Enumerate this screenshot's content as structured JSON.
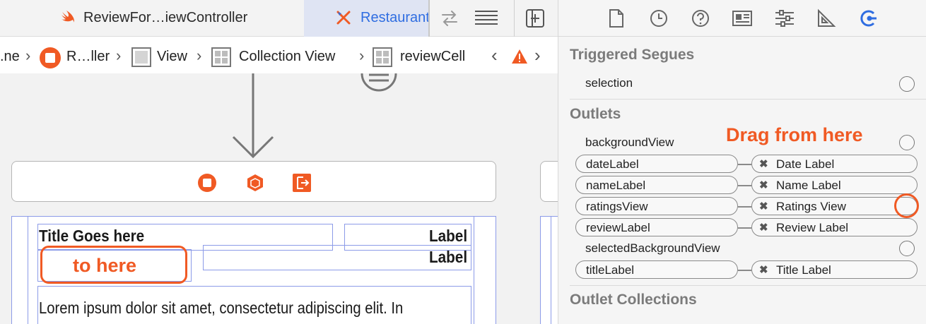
{
  "tabs": [
    {
      "label": "ReviewFor…iewController",
      "icon": "swift-icon",
      "active": false
    },
    {
      "label": "Restaurant",
      "icon": "storyboard-icon",
      "active": true
    }
  ],
  "toolbar_icons": [
    "swap-arrows-icon",
    "lines-icon",
    "add-editor-icon"
  ],
  "breadcrumbs": [
    {
      "label": ".ne",
      "icon": ""
    },
    {
      "label": "R…ller",
      "icon": "view-controller-icon"
    },
    {
      "label": "View",
      "icon": "view-icon"
    },
    {
      "label": "Collection View",
      "icon": "collection-view-icon"
    },
    {
      "label": "reviewCell",
      "icon": "collection-cell-icon"
    }
  ],
  "canvas": {
    "title_label": "Title Goes here",
    "label1": "Label",
    "label2": "Label",
    "body_text": "Lorem ipsum dolor sit amet, consectetur adipiscing elit. In",
    "annotation_to": "to here"
  },
  "inspector": {
    "tab_icons": [
      "file-icon",
      "clock-icon",
      "help-icon",
      "identity-icon",
      "sliders-icon",
      "ruler-icon",
      "connections-icon"
    ],
    "triggered_segues_header": "Triggered Segues",
    "segues": [
      {
        "name": "selection"
      }
    ],
    "outlets_header": "Outlets",
    "annotation_from": "Drag from here",
    "outlets": [
      {
        "name": "backgroundView",
        "target": "",
        "connected": false
      },
      {
        "name": "dateLabel",
        "target": "Date Label",
        "connected": true
      },
      {
        "name": "nameLabel",
        "target": "Name Label",
        "connected": true
      },
      {
        "name": "ratingsView",
        "target": "Ratings View",
        "connected": true
      },
      {
        "name": "reviewLabel",
        "target": "Review Label",
        "connected": true
      },
      {
        "name": "selectedBackgroundView",
        "target": "",
        "connected": false
      },
      {
        "name": "titleLabel",
        "target": "Title Label",
        "connected": true
      }
    ],
    "outlet_collections_header": "Outlet Collections"
  },
  "colors": {
    "accent_orange": "#f05a24",
    "selection_blue": "#2f6de1"
  }
}
